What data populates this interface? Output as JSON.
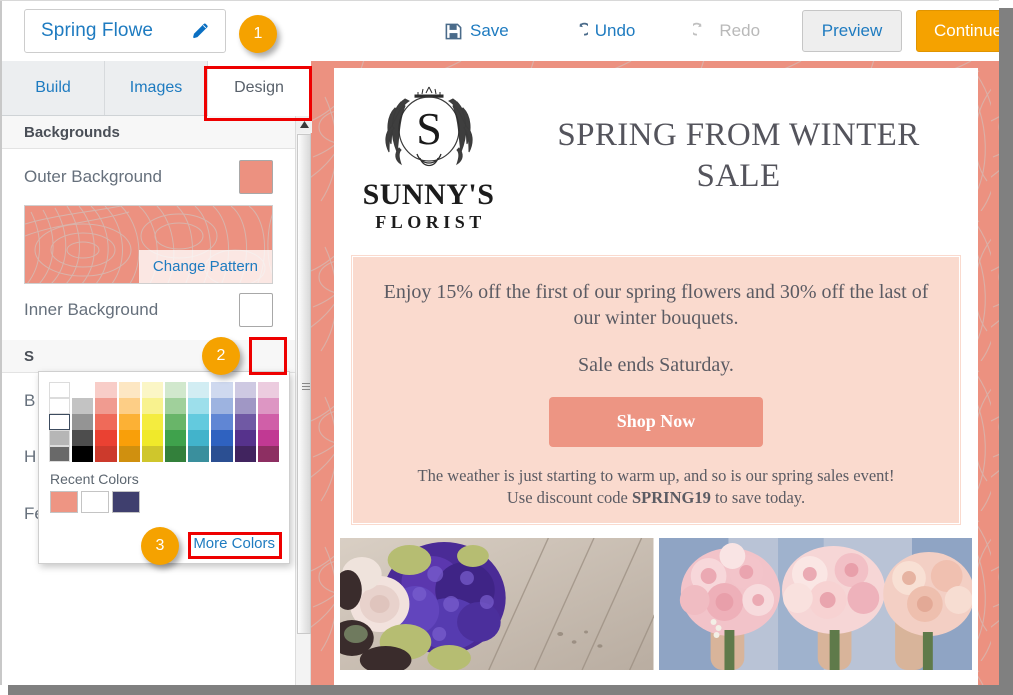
{
  "toolbar": {
    "campaign_title": "Spring Flowe",
    "pencil_icon": "pencil-icon",
    "save_label": "Save",
    "undo_label": "Undo",
    "redo_label": "Redo",
    "preview_label": "Preview",
    "continue_label": "Continue",
    "accent_orange": "#f5a200",
    "link_blue": "#1e7bc0",
    "disabled_grey": "#b9b9b9"
  },
  "tabs": [
    {
      "label": "Build",
      "active": false
    },
    {
      "label": "Images",
      "active": false
    },
    {
      "label": "Design",
      "active": true
    }
  ],
  "sidebar": {
    "section_backgrounds": "Backgrounds",
    "outer_background": {
      "label": "Outer Background",
      "swatch": "#ec9180"
    },
    "pattern": {
      "change_label": "Change Pattern",
      "base_color": "#ec9180",
      "line_color": "#d8b4ab"
    },
    "inner_background": {
      "label": "Inner Background",
      "swatch": "#ffffff"
    },
    "hidden_section_header": "S",
    "hidden_row_1": "B",
    "hidden_row_2": "H",
    "feature_articles": {
      "label": "Feature Articles",
      "swatch": "#fadfce"
    }
  },
  "color_picker": {
    "recent_label": "Recent Colors",
    "more_colors_label": "More Colors",
    "selected_index": {
      "col": 0,
      "row": 2
    },
    "columns": [
      [
        "#ffffff",
        "#ffffff",
        "#ffffff",
        "#b6b6b6",
        "#696969"
      ],
      [
        "#ffffff",
        "#c3c3c3",
        "#949494",
        "#4d4d4d",
        "#000000"
      ],
      [
        "#f8cdc8",
        "#f09b90",
        "#ef6a59",
        "#ea4132",
        "#cc3a2c"
      ],
      [
        "#fde7c3",
        "#fdce86",
        "#fcb135",
        "#f99f09",
        "#d0900f"
      ],
      [
        "#fbf6c6",
        "#f8f28e",
        "#f4ec3f",
        "#f0e92a",
        "#cfc62c"
      ],
      [
        "#d1e8cd",
        "#a0d09b",
        "#69b569",
        "#3fa24c",
        "#33803b"
      ],
      [
        "#d2edf3",
        "#9ddfeb",
        "#63cade",
        "#42b3cb",
        "#3a8f9d"
      ],
      [
        "#cfd9ef",
        "#9db3e0",
        "#6086d4",
        "#2f62c0",
        "#2b4f92"
      ],
      [
        "#cec9e2",
        "#a097c5",
        "#7059a4",
        "#56328c",
        "#41245f"
      ],
      [
        "#ecccdf",
        "#dd96c3",
        "#d05fa8",
        "#c13993",
        "#8d2f62"
      ]
    ],
    "recent_colors": [
      "#ee9583",
      "#ffffff",
      "#3f3f6e"
    ]
  },
  "email_preview": {
    "logo": {
      "monogram": "S",
      "brand_line_1": "SUNNY'S",
      "brand_line_2": "FLORIST",
      "wreath_icon": "laurel-wreath-icon"
    },
    "headline": "SPRING FROM WINTER SALE",
    "body_paragraph_1": "Enjoy 15% off the first of our spring flowers and 30% off the last of our winter bouquets.",
    "body_paragraph_2": "Sale ends Saturday.",
    "cta_label": "Shop Now",
    "footer_line_1": "The weather is just starting to warm up, and so is our spring sales event!",
    "footer_line_2_pre": "Use discount code ",
    "footer_line_2_code": "SPRING19",
    "footer_line_2_post": " to save today.",
    "inner_panel_color": "#fadace",
    "cta_color": "#ed9583",
    "images": [
      {
        "name": "purple-hydrangea-bouquet-photo"
      },
      {
        "name": "pink-rose-bouquets-photo"
      }
    ]
  },
  "callouts": [
    {
      "number": "1",
      "target": "design-tab"
    },
    {
      "number": "2",
      "target": "inner-background-swatch"
    },
    {
      "number": "3",
      "target": "more-colors-link"
    }
  ],
  "highlight_color": "#ee0000"
}
